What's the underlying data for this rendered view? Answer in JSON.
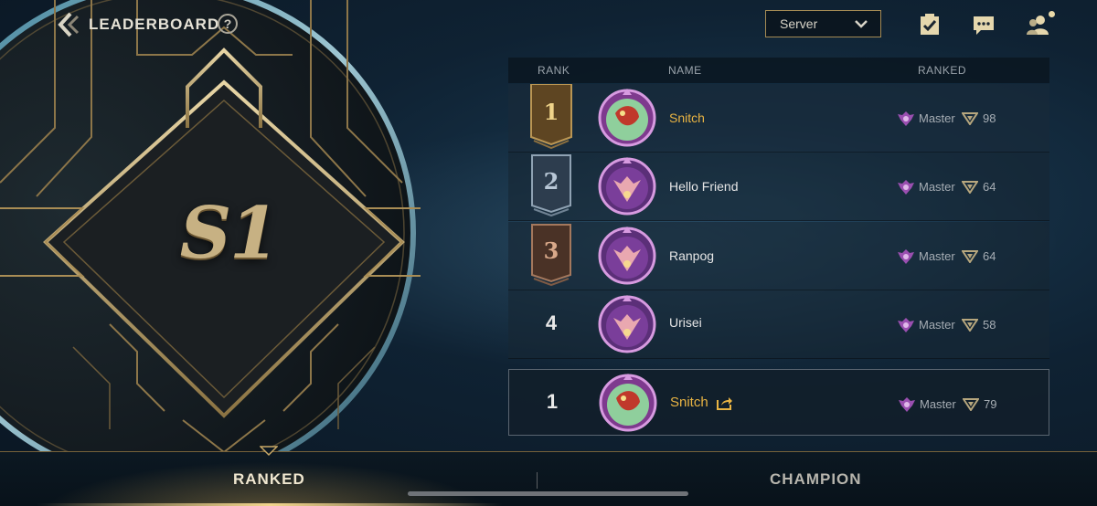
{
  "header": {
    "title": "LEADERBOARD",
    "help_label": "?",
    "server_select": {
      "value": "Server"
    },
    "icons": [
      "back-arrow-icon",
      "help-icon",
      "clipboard-check-icon",
      "chat-icon",
      "friends-icon"
    ]
  },
  "season": {
    "label": "S1"
  },
  "table": {
    "columns": {
      "rank": "RANK",
      "name": "NAME",
      "ranked": "RANKED"
    },
    "rows": [
      {
        "rank": "1",
        "name": "Snitch",
        "tier": "Master",
        "points": "98"
      },
      {
        "rank": "2",
        "name": "Hello Friend",
        "tier": "Master",
        "points": "64"
      },
      {
        "rank": "3",
        "name": "Ranpog",
        "tier": "Master",
        "points": "64"
      },
      {
        "rank": "4",
        "name": "Urisei",
        "tier": "Master",
        "points": "58"
      }
    ]
  },
  "self_row": {
    "rank": "1",
    "name": "Snitch",
    "tier": "Master",
    "points": "79"
  },
  "tabs": {
    "ranked": "RANKED",
    "champion": "CHAMPION",
    "active": "ranked"
  },
  "colors": {
    "gold": "#e9b443",
    "accent_border": "#a48a54",
    "background": "#0f2233"
  }
}
